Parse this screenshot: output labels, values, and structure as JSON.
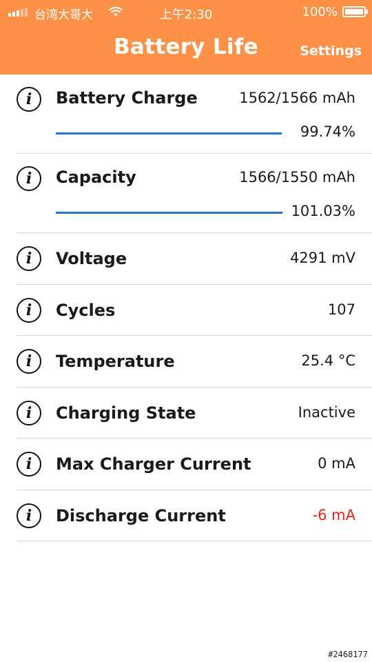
{
  "status_bar": {
    "carrier": "台湾大哥大",
    "time": "上午2:30",
    "battery_percent": "100%",
    "signal_strength": 0.6,
    "icons": [
      "signal-bars-icon",
      "wifi-icon",
      "battery-icon"
    ]
  },
  "nav": {
    "title": "Battery Life",
    "settings_label": "Settings"
  },
  "colors": {
    "header": "#fc9147",
    "progress": "#2a74d4",
    "negative": "#e8231a"
  },
  "rows": [
    {
      "label": "Battery Charge",
      "value": "1562/1566 mAh",
      "percent": "99.74%",
      "progress": 0.9974
    },
    {
      "label": "Capacity",
      "value": "1566/1550 mAh",
      "percent": "101.03%",
      "progress": 1.0
    },
    {
      "label": "Voltage",
      "value": "4291 mV"
    },
    {
      "label": "Cycles",
      "value": "107"
    },
    {
      "label": "Temperature",
      "value": "25.4 °C"
    },
    {
      "label": "Charging State",
      "value": "Inactive"
    },
    {
      "label": "Max Charger Current",
      "value": "0 mA"
    },
    {
      "label": "Discharge Current",
      "value": "-6 mA",
      "negative": true
    }
  ],
  "info_icon_glyph": "i",
  "watermark": "#2468177"
}
